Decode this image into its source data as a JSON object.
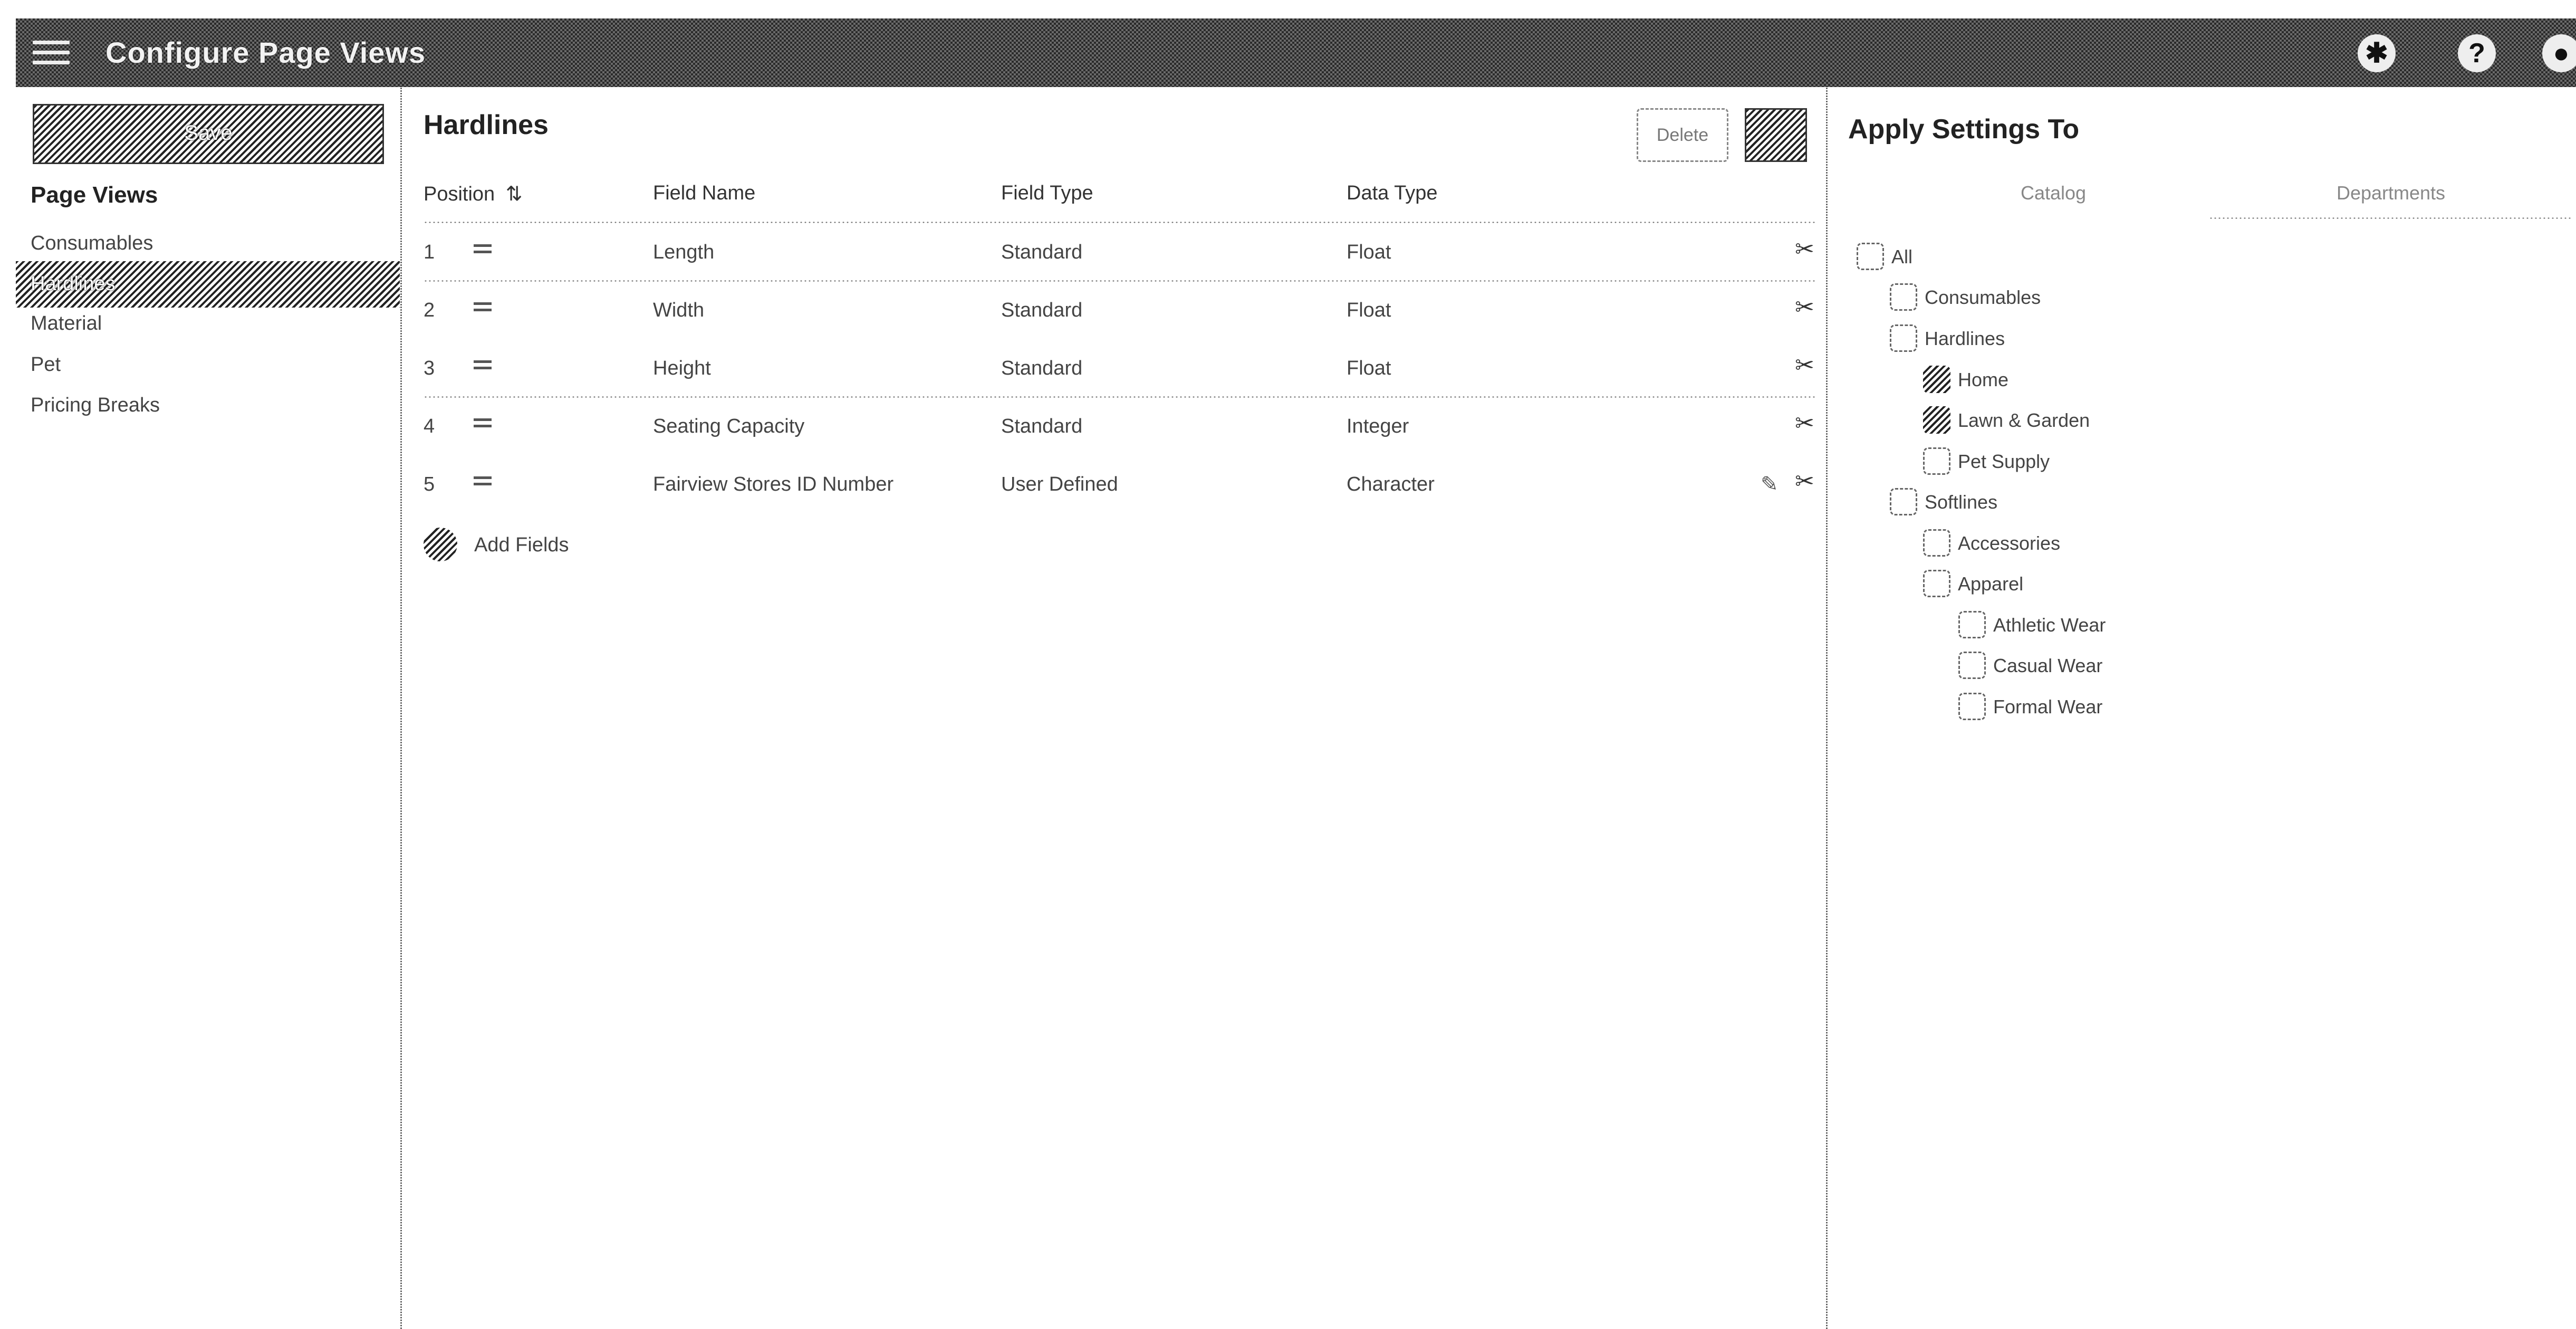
{
  "header": {
    "title": "Configure Page Views",
    "help_glyph": "?"
  },
  "sidebar": {
    "save_label": "Save",
    "heading": "Page Views",
    "items": [
      {
        "label": "Consumables"
      },
      {
        "label": "Hardlines",
        "active": true
      },
      {
        "label": "Material"
      },
      {
        "label": "Pet"
      },
      {
        "label": "Pricing Breaks"
      }
    ]
  },
  "main": {
    "title": "Hardlines",
    "delete_label": "Delete",
    "edit_label": "Edit",
    "columns": [
      "Position",
      "Field Name",
      "Field Type",
      "Data Type"
    ],
    "sort_glyph": "⇅",
    "rows": [
      {
        "position": "1",
        "field_name": "Length",
        "field_type": "Standard",
        "data_type": "Float"
      },
      {
        "position": "2",
        "field_name": "Width",
        "field_type": "Standard",
        "data_type": "Float"
      },
      {
        "position": "3",
        "field_name": "Height",
        "field_type": "Standard",
        "data_type": "Float"
      },
      {
        "position": "4",
        "field_name": "Seating Capacity",
        "field_type": "Standard",
        "data_type": "Integer"
      },
      {
        "position": "5",
        "field_name": "Fairview Stores ID Number",
        "field_type": "User Defined",
        "data_type": "Character"
      }
    ],
    "add_fields_label": "Add Fields"
  },
  "apply": {
    "title": "Apply Settings To",
    "tabs": [
      "Catalog",
      "Departments"
    ],
    "active_tab": "Departments",
    "tree": [
      {
        "label": "All",
        "checked": false
      },
      {
        "label": "Consumables",
        "checked": false
      },
      {
        "label": "Hardlines",
        "checked": false
      },
      {
        "label": "Home",
        "checked": true
      },
      {
        "label": "Lawn & Garden",
        "checked": true
      },
      {
        "label": "Pet Supply",
        "checked": false
      },
      {
        "label": "Softlines",
        "checked": false
      },
      {
        "label": "Accessories",
        "checked": false
      },
      {
        "label": "Apparel",
        "checked": false
      },
      {
        "label": "Athletic Wear",
        "checked": false
      },
      {
        "label": "Casual Wear",
        "checked": false
      },
      {
        "label": "Formal Wear",
        "checked": false
      }
    ]
  }
}
